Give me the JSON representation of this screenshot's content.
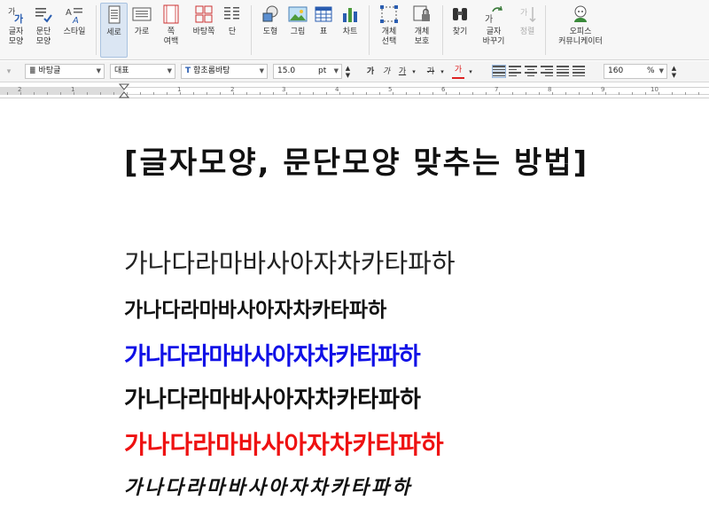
{
  "ribbon": {
    "char_shape": "글자\n모양",
    "para_shape": "문단\n모양",
    "style": "스타일",
    "vertical": "세로",
    "horizontal": "가로",
    "page_margin": "쪽\n여백",
    "page_color": "바탕쪽",
    "columns": "단",
    "shapes": "도형",
    "picture": "그림",
    "table": "표",
    "chart": "차트",
    "obj_select": "개체\n선택",
    "obj_protect": "개체\n보호",
    "find": "찾기",
    "char_replace": "글자\n바꾸기",
    "sort": "정렬",
    "office_community": "오피스\n커뮤니케이터"
  },
  "formatbar": {
    "style_value": "바탕글",
    "lang_value": "대표",
    "font_value": "함초롬바탕",
    "size_value": "15.0",
    "size_unit": "pt",
    "bold": "가",
    "italic": "가",
    "underline": "가",
    "strike": "가",
    "color": "가",
    "zoom_value": "160",
    "zoom_unit": "%"
  },
  "ruler": {
    "numbers": [
      "2",
      "1",
      "1",
      "2",
      "3",
      "4",
      "5",
      "6",
      "7",
      "8",
      "9",
      "10"
    ]
  },
  "document": {
    "title": "[글자모양, 문단모양 맞추는 방법]",
    "lines": [
      "가나다라마바사아자차카타파하",
      "가나다라마바사아자차카타파하",
      "가나다라마바사아자차카타파하",
      "가나다라마바사아자차카타파하",
      "가나다라마바사아자차카타파하",
      "가나다라마바사아자차카타파하"
    ]
  },
  "colors": {
    "blue_text": "#1010e6",
    "red_text": "#ee1111",
    "active_btn": "#dbe6f3"
  }
}
